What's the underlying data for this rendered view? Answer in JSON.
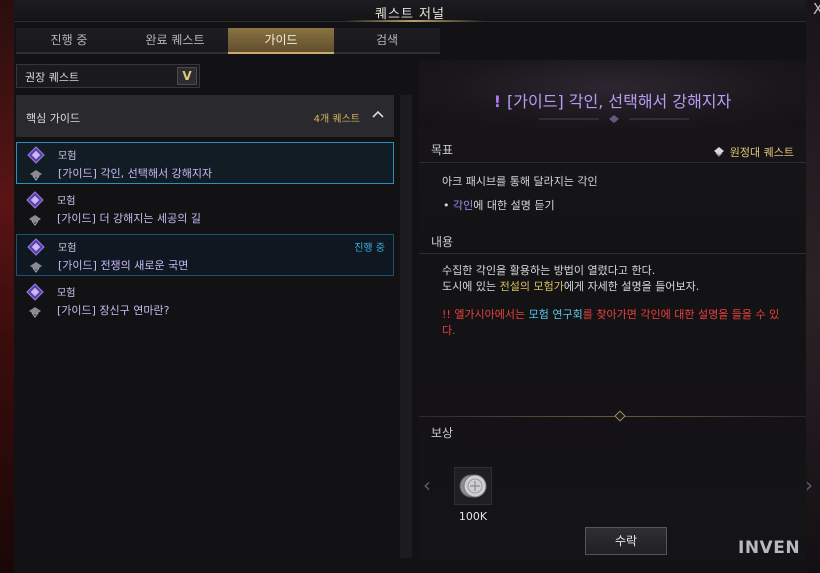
{
  "window": {
    "title": "퀘스트 저널",
    "close_label": "X"
  },
  "tabs": [
    {
      "label": "진행 중"
    },
    {
      "label": "완료 퀘스트"
    },
    {
      "label": "가이드"
    },
    {
      "label": "검색"
    }
  ],
  "filter": {
    "selected": "권장 퀘스트",
    "toggle_glyph": "V"
  },
  "group": {
    "title": "핵심 가이드",
    "count": "4개 퀘스트",
    "collapse_glyph": "^"
  },
  "quests": [
    {
      "category": "모험",
      "name": "[가이드] 각인, 선택해서 강해지자",
      "status": "",
      "selected": true
    },
    {
      "category": "모험",
      "name": "[가이드] 더 강해지는 세공의 길",
      "status": ""
    },
    {
      "category": "모험",
      "name": "[가이드] 전쟁의 새로운 국면",
      "status": "진행 중"
    },
    {
      "category": "모험",
      "name": "[가이드] 장신구 연마란?",
      "status": ""
    }
  ],
  "detail": {
    "title_mark": "!",
    "title": "[가이드] 각인, 선택해서 강해지자",
    "goal_label": "목표",
    "quest_type": "원정대 퀘스트",
    "goal_text": "아크 패시브를 통해 달라지는 각인",
    "goal_bullet_prefix": "• ",
    "goal_bullet_highlight": "각인",
    "goal_bullet_rest": "에 대한 설명 듣기",
    "content_label": "내용",
    "content_line1": "수집한 각인을 활용하는 방법이 열렸다고 한다.",
    "content_line2_pre": "도시에 있는 ",
    "content_line2_highlight": "전설의 모험가",
    "content_line2_post": "에게 자세한 설명을 들어보자.",
    "warn_pre": "!! 엘가시아에서는 ",
    "warn_highlight": "모험 연구회",
    "warn_post": "를 찾아가면 각인에 대한 설명을 들을 수 있다.",
    "reward_label": "보상",
    "reward_amount": "100K",
    "accept_label": "수락"
  },
  "watermark": "INVEN",
  "colors": {
    "accent_gold": "#c9ac6c",
    "quest_purple": "#c8b9f2",
    "progress_blue": "#3ab0e0",
    "warn_red": "#e8413c"
  },
  "icons": [
    "quest-book-icon",
    "expedition-icon",
    "coin-icon",
    "chevron-left-icon",
    "chevron-right-icon"
  ]
}
